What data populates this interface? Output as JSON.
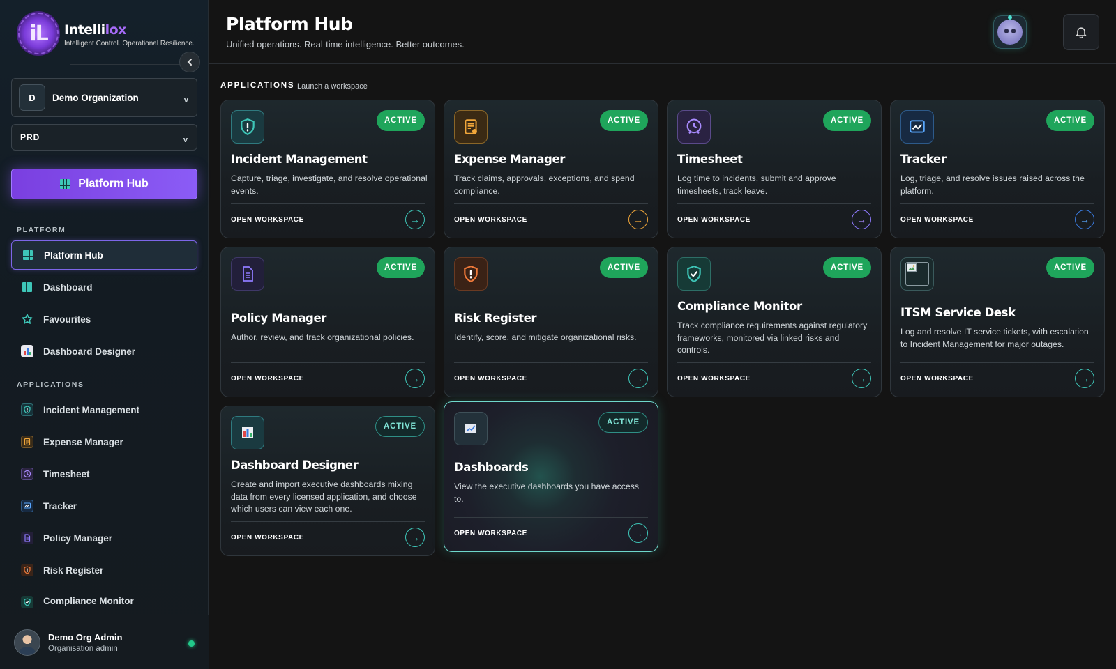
{
  "brand": {
    "logo_letters": "iL",
    "name_part1": "Intelli",
    "name_part2": "lox",
    "tagline": "Intelligent Control. Operational Resilience."
  },
  "sidebar": {
    "collapse_icon": "chevron-left-icon",
    "org": {
      "badge": "D",
      "name": "Demo Organization",
      "chevron": "v"
    },
    "env": {
      "value": "PRD",
      "chevron": "v"
    },
    "primary_button": "Platform Hub",
    "platform_label": "PLATFORM",
    "platform_items": [
      {
        "label": "Platform Hub",
        "icon": "grid-icon",
        "active": true
      },
      {
        "label": "Dashboard",
        "icon": "grid-icon"
      },
      {
        "label": "Favourites",
        "icon": "star-icon"
      },
      {
        "label": "Dashboard Designer",
        "icon": "bar-chart-icon"
      }
    ],
    "apps_label": "APPLICATIONS",
    "app_items": [
      {
        "label": "Incident Management",
        "icon": "shield-alert-icon"
      },
      {
        "label": "Expense Manager",
        "icon": "receipt-icon"
      },
      {
        "label": "Timesheet",
        "icon": "clock-icon"
      },
      {
        "label": "Tracker",
        "icon": "trend-chart-icon"
      },
      {
        "label": "Policy Manager",
        "icon": "document-icon"
      },
      {
        "label": "Risk Register",
        "icon": "shield-warning-icon"
      },
      {
        "label": "Compliance Monitor",
        "icon": "shield-check-icon"
      }
    ],
    "user": {
      "name": "Demo Org Admin",
      "role": "Organisation admin"
    }
  },
  "header": {
    "title": "Platform Hub",
    "subtitle": "Unified operations. Real-time intelligence. Better outcomes."
  },
  "apps_section": {
    "label": "APPLICATIONS",
    "sub": "Launch a workspace"
  },
  "cards": [
    {
      "title": "Incident Management",
      "desc": "Capture, triage, investigate, and resolve operational events.",
      "badge": "ACTIVE",
      "footer": "OPEN WORKSPACE",
      "icon": "shield-alert-icon"
    },
    {
      "title": "Expense Manager",
      "desc": "Track claims, approvals, exceptions, and spend compliance.",
      "badge": "ACTIVE",
      "footer": "OPEN WORKSPACE",
      "icon": "receipt-icon"
    },
    {
      "title": "Timesheet",
      "desc": "Log time to incidents, submit and approve timesheets, track leave.",
      "badge": "ACTIVE",
      "footer": "OPEN WORKSPACE",
      "icon": "clock-icon"
    },
    {
      "title": "Tracker",
      "desc": "Log, triage, and resolve issues raised across the platform.",
      "badge": "ACTIVE",
      "footer": "OPEN WORKSPACE",
      "icon": "trend-chart-icon"
    },
    {
      "title": "Policy Manager",
      "desc": "Author, review, and track organizational policies.",
      "badge": "ACTIVE",
      "footer": "OPEN WORKSPACE",
      "icon": "document-icon"
    },
    {
      "title": "Risk Register",
      "desc": "Identify, score, and mitigate organizational risks.",
      "badge": "ACTIVE",
      "footer": "OPEN WORKSPACE",
      "icon": "shield-warning-icon"
    },
    {
      "title": "Compliance Monitor",
      "desc": "Track compliance requirements against regulatory frameworks, monitored via linked risks and controls.",
      "badge": "ACTIVE",
      "footer": "OPEN WORKSPACE",
      "icon": "shield-check-icon"
    },
    {
      "title": "ITSM Service Desk",
      "desc": "Log and resolve IT service tickets, with escalation to Incident Management for major outages.",
      "badge": "ACTIVE",
      "footer": "OPEN WORKSPACE",
      "icon": "broken-image-icon"
    },
    {
      "title": "Dashboard Designer",
      "desc": "Create and import executive dashboards mixing data from every licensed application, and choose which users can view each one.",
      "badge": "ACTIVE",
      "footer": "OPEN WORKSPACE",
      "icon": "bar-chart-icon"
    },
    {
      "title": "Dashboards",
      "desc": "View the executive dashboards you have access to.",
      "badge": "ACTIVE",
      "footer": "OPEN WORKSPACE",
      "icon": "line-chart-icon"
    }
  ],
  "colors": {
    "accent_purple": "#8b5cf6",
    "accent_teal": "#3ec6b8",
    "active_green": "#1fa55b",
    "background": "#141414"
  }
}
